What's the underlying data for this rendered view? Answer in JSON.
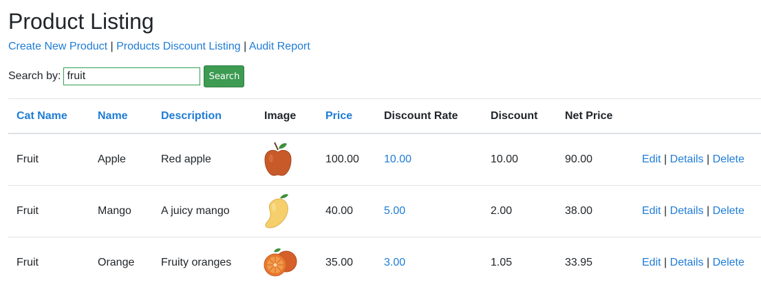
{
  "page": {
    "title": "Product Listing",
    "links": [
      "Create New Product",
      "Products Discount Listing",
      "Audit Report"
    ],
    "link_separator": "|"
  },
  "search": {
    "label": "Search by:",
    "value": "fruit",
    "button_label": "Search"
  },
  "table": {
    "headers": {
      "cat_name": "Cat Name",
      "name": "Name",
      "description": "Description",
      "image": "Image",
      "price": "Price",
      "discount_rate": "Discount Rate",
      "discount": "Discount",
      "net_price": "Net Price"
    },
    "rows": [
      {
        "cat_name": "Fruit",
        "name": "Apple",
        "description": "Red apple",
        "image_icon": "apple-icon",
        "price": "100.00",
        "discount_rate": "10.00",
        "discount": "10.00",
        "net_price": "90.00"
      },
      {
        "cat_name": "Fruit",
        "name": "Mango",
        "description": "A juicy mango",
        "image_icon": "mango-icon",
        "price": "40.00",
        "discount_rate": "5.00",
        "discount": "2.00",
        "net_price": "38.00"
      },
      {
        "cat_name": "Fruit",
        "name": "Orange",
        "description": "Fruity oranges",
        "image_icon": "orange-icon",
        "price": "35.00",
        "discount_rate": "3.00",
        "discount": "1.05",
        "net_price": "33.95"
      }
    ],
    "actions": {
      "edit": "Edit",
      "details": "Details",
      "delete": "Delete",
      "separator": "|"
    }
  },
  "colors": {
    "link": "#1e7cd6",
    "search_button": "#3d9b52",
    "input_border": "#2e9e4f"
  }
}
